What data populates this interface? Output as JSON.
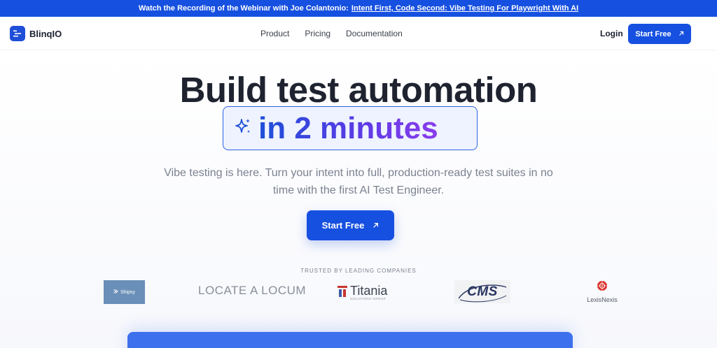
{
  "banner": {
    "text": "Watch the Recording of the Webinar with Joe Colantonio:",
    "link": "Intent First, Code Second: Vibe Testing For Playwright With AI"
  },
  "nav": {
    "brand": "BlinqIO",
    "links": [
      "Product",
      "Pricing",
      "Documentation"
    ],
    "login": "Login",
    "cta": "Start Free"
  },
  "hero": {
    "headline": "Build test automation",
    "highlight": "in 2 minutes",
    "subtext": "Vibe testing is here. Turn your intent into full, production-ready test suites in no time with the first AI Test Engineer.",
    "cta": "Start Free"
  },
  "trusted": {
    "label": "TRUSTED BY LEADING COMPANIES",
    "companies": {
      "shipsy": "Shipsy",
      "locum": "LOCATE A LOCUM",
      "titania": "Titania",
      "titania_sub": "SOLUTIONS GROUP",
      "cms": "CMS",
      "lexis": "LexisNexis"
    }
  },
  "colors": {
    "brand_blue": "#1650e0",
    "gradient_start": "#1d4fd8",
    "gradient_end": "#8a3cec"
  },
  "icons": {
    "logo": "blinqio-logo-icon",
    "arrow": "arrow-up-right-icon",
    "sparkle": "sparkle-icon"
  }
}
